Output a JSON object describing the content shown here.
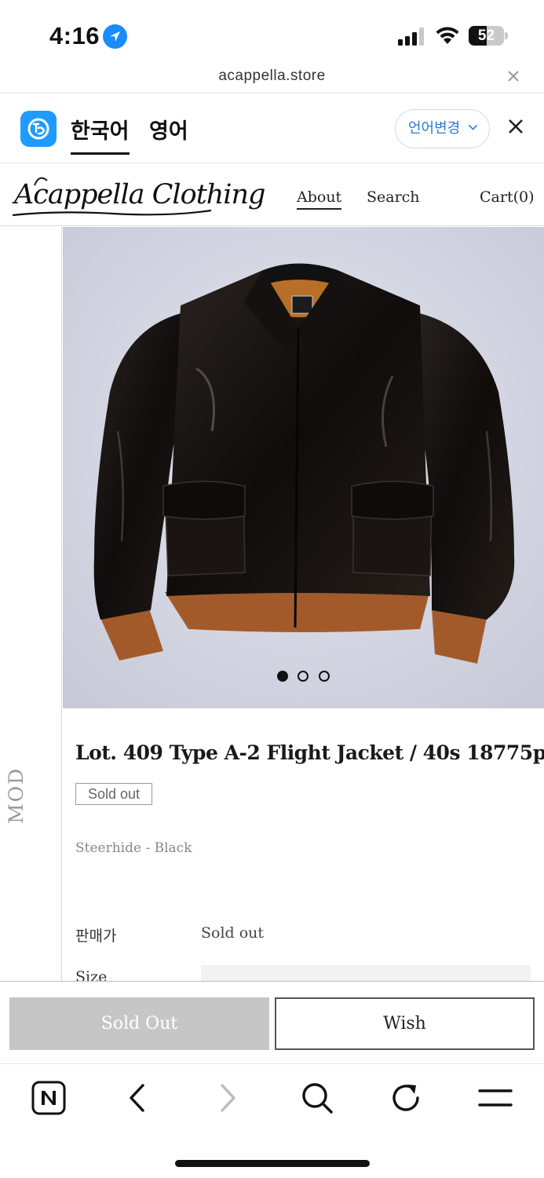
{
  "status_bar": {
    "time": "4:16",
    "battery_level": "52",
    "icons": [
      "location-arrow-icon",
      "cellular-signal-icon",
      "wifi-icon",
      "battery-icon"
    ]
  },
  "url_bar": {
    "url": "acappella.store",
    "close_icon": "close-icon"
  },
  "translate_bar": {
    "languages": [
      "한국어",
      "영어"
    ],
    "active_language": "한국어",
    "change_button": "언어변경",
    "icons": [
      "translate-app-icon",
      "chevron-down-icon",
      "close-icon"
    ]
  },
  "site_header": {
    "logo_text": "Acappella Clothing",
    "nav": {
      "about": "About",
      "search": "Search",
      "cart": "Cart(0)"
    }
  },
  "side_strip": {
    "label": "MOD"
  },
  "product": {
    "image": "black leather A-2 flight jacket with brown knit cuffs and waistband",
    "carousel": {
      "total": 3,
      "active_index": 0
    },
    "title": "Lot. 409 Type A-2 Flight Jacket / 40s 18775p",
    "badge": "Sold out",
    "subtitle": "Steerhide - Black",
    "price_label": "판매가",
    "price_value": "Sold out",
    "size_label": "Size"
  },
  "actions": {
    "sold_out_button": "Sold Out",
    "wish_button": "Wish"
  },
  "browser_toolbar": {
    "icons": [
      "naver-home-icon",
      "back-arrow-icon",
      "forward-arrow-icon",
      "search-icon",
      "refresh-icon",
      "menu-icon"
    ]
  },
  "colors": {
    "accent_blue": "#1f9bff",
    "sold_out_gray": "#c6c6c6",
    "jacket_leather": "#15110f",
    "jacket_rib": "#a35a2a"
  }
}
